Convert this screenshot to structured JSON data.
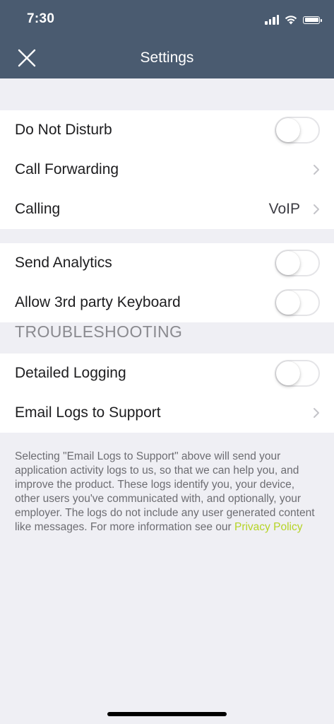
{
  "status_bar": {
    "time": "7:30",
    "signal_icon": "cellular-signal-icon",
    "wifi_icon": "wifi-icon",
    "battery_icon": "battery-icon"
  },
  "nav": {
    "title": "Settings",
    "close_icon": "close-icon"
  },
  "group1": {
    "do_not_disturb": {
      "label": "Do Not Disturb",
      "enabled": false
    },
    "call_forwarding": {
      "label": "Call Forwarding"
    },
    "calling": {
      "label": "Calling",
      "value": "VoIP"
    }
  },
  "group2": {
    "send_analytics": {
      "label": "Send Analytics",
      "enabled": false
    },
    "third_party_keyboard": {
      "label": "Allow 3rd party Keyboard",
      "enabled": false
    }
  },
  "troubleshooting": {
    "header": "TROUBLESHOOTING",
    "detailed_logging": {
      "label": "Detailed Logging",
      "enabled": false
    },
    "email_logs": {
      "label": "Email Logs to Support"
    }
  },
  "footnote": {
    "text": "Selecting \"Email Logs to Support\" above will send your application activity logs to us, so that we can help you, and improve the product. These logs identify you, your device, other users you've communicated with, and optionally, your employer. The logs do not include any user generated content like messages. For more information see our ",
    "link": "Privacy Policy"
  },
  "colors": {
    "nav_background": "#4a5b70",
    "page_background": "#efeff4",
    "link": "#b5d425"
  }
}
